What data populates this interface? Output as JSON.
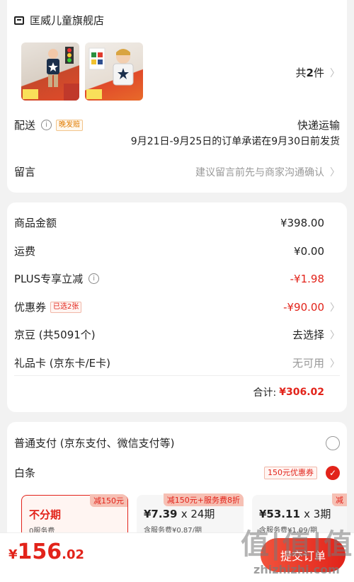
{
  "shop": {
    "name": "匡威儿童旗舰店",
    "count_prefix": "共",
    "count": "2",
    "count_suffix": "件"
  },
  "shipping": {
    "label": "配送",
    "late_tag": "晚发赔",
    "method": "快递运输",
    "promise": "9月21日-9月25日的订单承诺在9月30日前发货"
  },
  "message": {
    "label": "留言",
    "placeholder": "建议留言前先与商家沟通确认"
  },
  "price": {
    "goods_label": "商品金额",
    "goods_value": "¥398.00",
    "freight_label": "运费",
    "freight_value": "¥0.00",
    "plus_label": "PLUS专享立减",
    "plus_value": "-¥1.98",
    "coupon_label": "优惠券",
    "coupon_tag": "已选2张",
    "coupon_value": "-¥90.00",
    "jd_label": "京豆 (共5091个)",
    "jd_value": "去选择",
    "gift_label": "礼品卡 (京东卡/E卡)",
    "gift_value": "无可用",
    "total_label": "合计:",
    "total_value": "¥306.02"
  },
  "payment": {
    "normal_label": "普通支付 (京东支付、微信支付等)",
    "baitiao_label": "白条",
    "baitiao_tag": "150元优惠券",
    "plans": [
      {
        "badge": "减150元",
        "main": "不分期",
        "sub": "0服务费"
      },
      {
        "badge": "减150元+服务费8折",
        "main_price": "¥7.39",
        "main_x": "x 24期",
        "sub": "含服务费¥0.87/期"
      },
      {
        "badge": "减",
        "main_price": "¥53.11",
        "main_x": "x 3期",
        "sub": "含服务费¥1.09/期"
      }
    ]
  },
  "bottom": {
    "total_symbol": "¥",
    "total_int": "156",
    "total_dec": ".02",
    "submit_label": "提交订单"
  },
  "watermark": {
    "text": "值|值|值",
    "domain": "zhizhizhi.com"
  },
  "colors": {
    "accent": "#e2231a",
    "background": "#f2f2f2"
  }
}
